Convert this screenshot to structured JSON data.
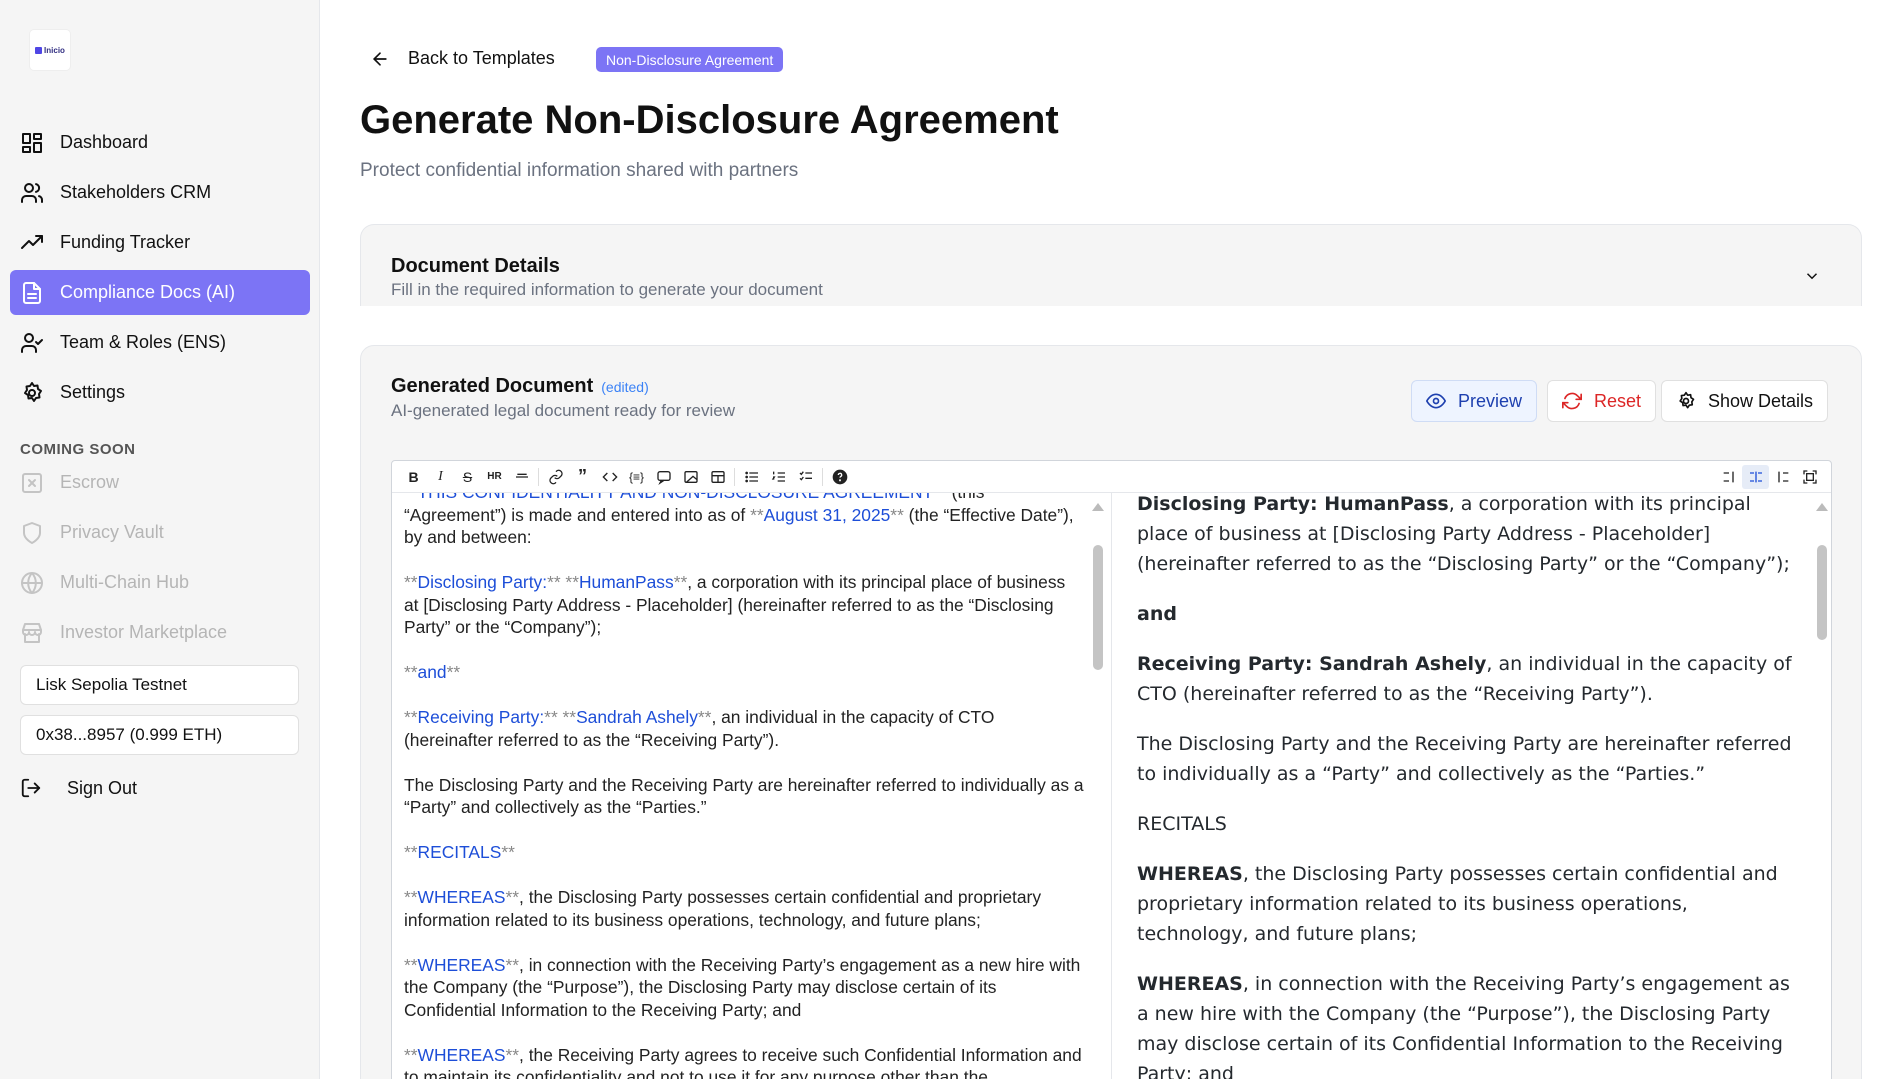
{
  "app": {
    "logo_text": "Inicio"
  },
  "sidebar": {
    "items": [
      {
        "label": "Dashboard",
        "icon": "dashboard-icon"
      },
      {
        "label": "Stakeholders CRM",
        "icon": "users-icon"
      },
      {
        "label": "Funding Tracker",
        "icon": "trending-up-icon"
      },
      {
        "label": "Compliance Docs (AI)",
        "icon": "file-text-icon",
        "active": true
      },
      {
        "label": "Team & Roles (ENS)",
        "icon": "user-check-icon"
      },
      {
        "label": "Settings",
        "icon": "gear-icon"
      }
    ],
    "coming_soon_title": "COMING SOON",
    "coming_soon": [
      {
        "label": "Escrow",
        "icon": "x-square-icon"
      },
      {
        "label": "Privacy Vault",
        "icon": "shield-icon"
      },
      {
        "label": "Multi-Chain Hub",
        "icon": "globe-icon"
      },
      {
        "label": "Investor Marketplace",
        "icon": "store-icon"
      }
    ],
    "network": "Lisk Sepolia Testnet",
    "wallet": "0x38...8957 (0.999 ETH)",
    "sign_out": "Sign Out"
  },
  "header": {
    "back_label": "Back to Templates",
    "badge": "Non-Disclosure Agreement",
    "title": "Generate Non-Disclosure Agreement",
    "subtitle": "Protect confidential information shared with partners"
  },
  "details_card": {
    "title": "Document Details",
    "subtitle": "Fill in the required information to generate your document"
  },
  "generated": {
    "title": "Generated Document",
    "edited": "(edited)",
    "subtitle": "AI-generated legal document ready for review",
    "preview_btn": "Preview",
    "reset_btn": "Reset",
    "details_btn": "Show Details"
  },
  "editor": {
    "toolbar": [
      "B",
      "I",
      "S",
      "HR",
      "H",
      "link",
      "quote",
      "code",
      "code-block",
      "comment",
      "image",
      "table",
      "ul",
      "ol",
      "checklist",
      "help"
    ],
    "left": {
      "line0a": "THIS CONFIDENTIALITY AND NON-DISCLOSURE AGREEMENT",
      "line0b": "(this",
      "p1_pre": "“Agreement”) is made and entered into as of ",
      "p1_date": "August 31, 2025",
      "p1_post": " (the “Effective Date”), by and between:",
      "p2_k1": "Disclosing Party:",
      "p2_k2": "HumanPass",
      "p2_rest": ", a corporation with its principal place of business at [Disclosing Party Address - Placeholder] (hereinafter referred to as the “Disclosing Party” or the “Company”);",
      "p3_k": "and",
      "p4_k1": "Receiving Party:",
      "p4_k2": "Sandrah Ashely",
      "p4_rest": ", an individual in the capacity of CTO (hereinafter referred to as the “Receiving Party”).",
      "p5": "The Disclosing Party and the Receiving Party are hereinafter referred to individually as a “Party” and collectively as the “Parties.”",
      "p6_k": "RECITALS",
      "p7_k": "WHEREAS",
      "p7_rest": ", the Disclosing Party possesses certain confidential and proprietary information related to its business operations, technology, and future plans;",
      "p8_k": "WHEREAS",
      "p8_rest": ", in connection with the Receiving Party’s engagement as a new hire with the Company (the “Purpose”), the Disclosing Party may disclose certain of its Confidential Information to the Receiving Party; and",
      "p9_k": "WHEREAS",
      "p9_rest": ", the Receiving Party agrees to receive such Confidential Information and to maintain its confidentiality and not to use it for any purpose other than the"
    },
    "right": {
      "p1_b": "Disclosing Party: HumanPass",
      "p1_rest": ", a corporation with its principal place of business at [Disclosing Party Address - Placeholder] (hereinafter referred to as the “Disclosing Party” or the “Company”);",
      "p2_b": "and",
      "p3_b": "Receiving Party: Sandrah Ashely",
      "p3_rest": ", an individual in the capacity of CTO (hereinafter referred to as the “Receiving Party”).",
      "p4": "The Disclosing Party and the Receiving Party are hereinafter referred to individually as a “Party” and collectively as the “Parties.”",
      "p5": "RECITALS",
      "p6_b": "WHEREAS",
      "p6_rest": ", the Disclosing Party possesses certain confidential and proprietary information related to its business operations, technology, and future plans;",
      "p7_b": "WHEREAS",
      "p7_rest": ", in connection with the Receiving Party’s engagement as a new hire with the Company (the “Purpose”), the Disclosing Party may disclose certain of its Confidential Information to the Receiving Party; and"
    }
  },
  "colors": {
    "accent": "#7c74f5",
    "link": "#1d4ed8",
    "danger": "#dc2626"
  }
}
